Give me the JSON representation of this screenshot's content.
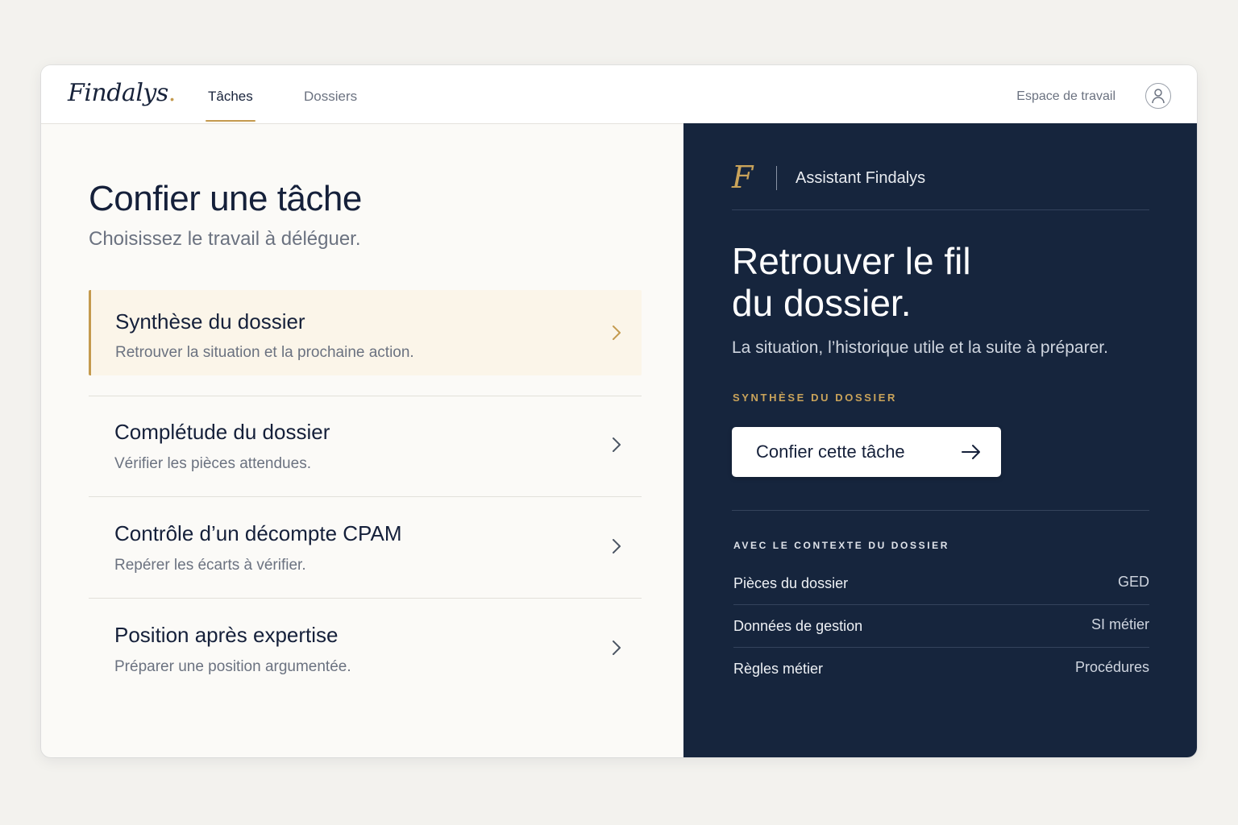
{
  "header": {
    "logo": "Findalys",
    "logo_dot": ".",
    "tabs": [
      {
        "label": "Tâches",
        "active": true
      },
      {
        "label": "Dossiers",
        "active": false
      }
    ],
    "workspace_label": "Espace de travail",
    "avatar_icon": "user-icon"
  },
  "main": {
    "title": "Confier une tâche",
    "subtitle": "Choisissez le travail à déléguer.",
    "tasks": [
      {
        "title": "Synthèse du dossier",
        "description": "Retrouver la situation et la prochaine action.",
        "selected": true
      },
      {
        "title": "Complétude du dossier",
        "description": "Vérifier les pièces attendues.",
        "selected": false
      },
      {
        "title": "Contrôle d’un décompte CPAM",
        "description": "Repérer les écarts à vérifier.",
        "selected": false
      },
      {
        "title": "Position après expertise",
        "description": "Préparer une position argumentée.",
        "selected": false
      }
    ]
  },
  "assistant": {
    "mark": "F",
    "name": "Assistant Findalys",
    "hero_title": "Retrouver le fil\ndu dossier.",
    "hero_subtitle": "La situation, l’historique utile et la suite à préparer.",
    "selected_task_label": "SYNTHÈSE DU DOSSIER",
    "cta_label": "Confier cette tâche",
    "context_label": "AVEC LE CONTEXTE DU DOSSIER",
    "context_items": [
      {
        "name": "Pièces du dossier",
        "source": "GED"
      },
      {
        "name": "Données de gestion",
        "source": "SI métier"
      },
      {
        "name": "Règles métier",
        "source": "Procédures"
      }
    ]
  },
  "colors": {
    "accent_gold": "#c49a4e",
    "navy_panel": "#16253d",
    "text_dark": "#15203a",
    "selected_bg": "#fbf5e9"
  }
}
